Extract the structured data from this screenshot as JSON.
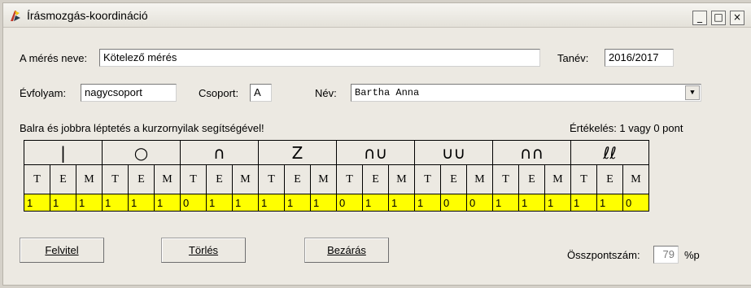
{
  "window": {
    "title": "Írásmozgás-koordináció",
    "minimize": "_",
    "maximize": "□",
    "close": "×"
  },
  "form": {
    "meres_label": "A mérés neve:",
    "meres_value": "Kötelező mérés",
    "tanev_label": "Tanév:",
    "tanev_value": "2016/2017",
    "evfolyam_label": "Évfolyam:",
    "evfolyam_value": "nagycsoport",
    "csoport_label": "Csoport:",
    "csoport_value": "A",
    "nev_label": "Név:",
    "nev_value": "Bartha Anna",
    "nev_dropdown_glyph": "▼",
    "instructions": "Balra és jobbra léptetés a kurzornyilak segítségével!",
    "ertekeles": "Értékelés: 1 vagy 0 pont"
  },
  "grid": {
    "symbols": [
      "|",
      "○",
      "∩",
      "Z",
      "∩∪",
      "∪∪",
      "∩∩",
      "ℓℓ"
    ],
    "subheaders": [
      "T",
      "E",
      "M"
    ],
    "values": [
      [
        "1",
        "1",
        "1"
      ],
      [
        "1",
        "1",
        "1"
      ],
      [
        "0",
        "1",
        "1"
      ],
      [
        "1",
        "1",
        "1"
      ],
      [
        "0",
        "1",
        "1"
      ],
      [
        "1",
        "0",
        "0"
      ],
      [
        "1",
        "1",
        "1"
      ],
      [
        "1",
        "1",
        "0"
      ]
    ]
  },
  "buttons": {
    "felvitel": "Felvitel",
    "torles": "Törlés",
    "bezaras": "Bezárás"
  },
  "score": {
    "label": "Összpontszám:",
    "value": "79",
    "unit": "%p"
  }
}
